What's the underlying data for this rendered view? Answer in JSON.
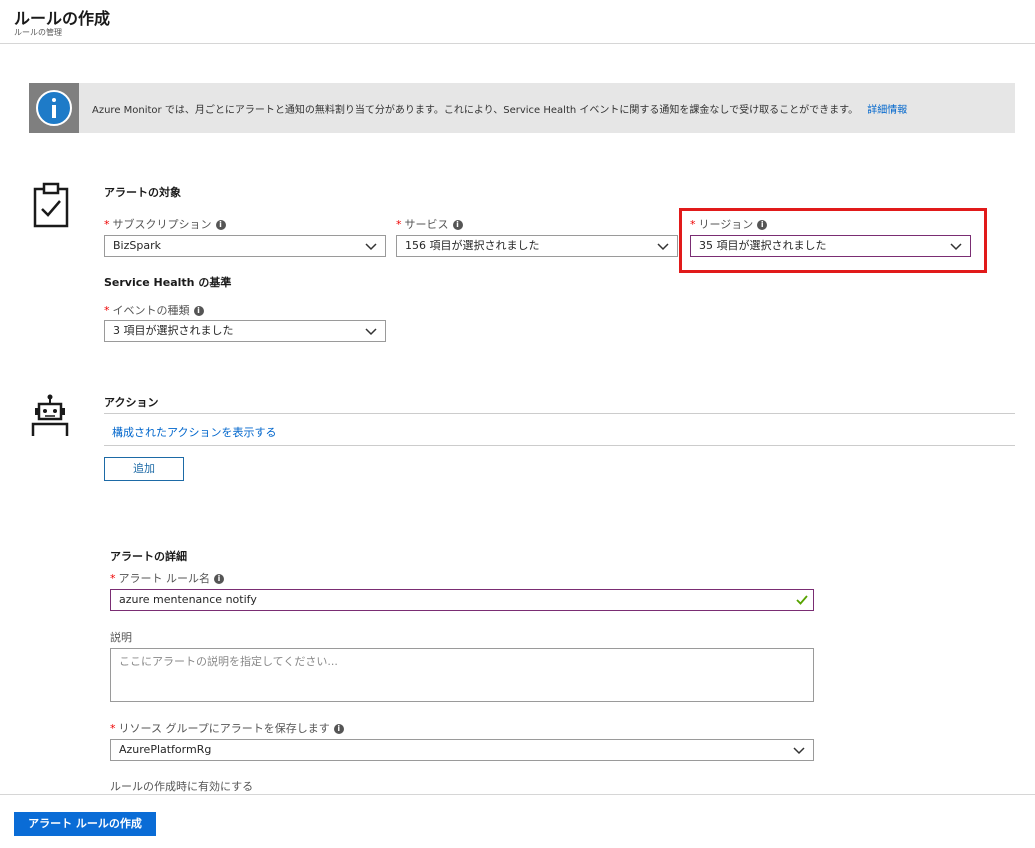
{
  "header": {
    "title": "ルールの作成",
    "subtitle": "ルールの管理"
  },
  "info_banner": {
    "text": "Azure Monitor では、月ごとにアラートと通知の無料割り当て分があります。これにより、Service Health イベントに関する通知を課金なしで受け取ることができます。",
    "link": "詳細情報"
  },
  "alert_target": {
    "title": "アラートの対象",
    "subscription": {
      "label": "サブスクリプション",
      "value": "BizSpark"
    },
    "service": {
      "label": "サービス",
      "value": "156 項目が選択されました"
    },
    "region": {
      "label": "リージョン",
      "value": "35 項目が選択されました"
    }
  },
  "service_health": {
    "title": "Service Health の基準",
    "event_type": {
      "label": "イベントの種類",
      "value": "3 項目が選択されました"
    }
  },
  "actions": {
    "title": "アクション",
    "show_link": "構成されたアクションを表示する",
    "add_button": "追加"
  },
  "alert_details": {
    "title": "アラートの詳細",
    "rule_name": {
      "label": "アラート ルール名",
      "value": "azure mentenance notify"
    },
    "description": {
      "label": "説明",
      "placeholder": "ここにアラートの説明を指定してください..."
    },
    "resource_group": {
      "label": "リソース グループにアラートを保存します",
      "value": "AzurePlatformRg"
    },
    "enable_label": "ルールの作成時に有効にする"
  },
  "footer": {
    "create_button": "アラート ルールの作成"
  },
  "common": {
    "required_mark": "*",
    "info_tip": "i"
  },
  "colors": {
    "accent": "#0a6cd6",
    "link": "#0066cc",
    "highlight": "#e11a1a",
    "active_border": "#7a2d73",
    "valid_check": "#57a300"
  }
}
